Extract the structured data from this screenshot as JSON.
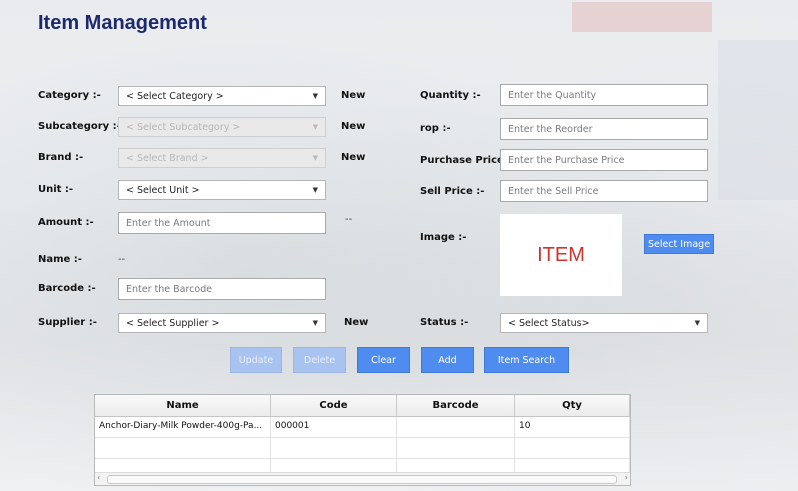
{
  "title": "Item Management",
  "labels": {
    "category": "Category :-",
    "subcategory": "Subcategory :-",
    "brand": "Brand :-",
    "unit": "Unit :-",
    "amount": "Amount :-",
    "name": "Name :-",
    "barcode": "Barcode :-",
    "supplier": "Supplier :-",
    "quantity": "Quantity :-",
    "rop": "rop :-",
    "purchase_price": "Purchase Price :-",
    "sell_price": "Sell Price :-",
    "image": "Image :-",
    "status": "Status :-"
  },
  "new_link": "New",
  "selects": {
    "category": "< Select Category >",
    "subcategory": "< Select Subcategory >",
    "brand": "< Select Brand >",
    "unit": "< Select Unit >",
    "supplier": "< Select Supplier >",
    "status": "< Select Status>"
  },
  "placeholders": {
    "amount": "Enter the Amount",
    "barcode": "Enter the Barcode",
    "quantity": "Enter the Quantity",
    "rop": "Enter the Reorder",
    "purchase_price": "Enter the Purchase Price",
    "sell_price": "Enter the Sell Price"
  },
  "name_value": "--",
  "amount_suffix": "--",
  "image_text": "ITEM",
  "buttons": {
    "select_image": "Select Image",
    "update": "Update",
    "delete": "Delete",
    "clear": "Clear",
    "add": "Add",
    "item_search": "Item Search"
  },
  "table": {
    "headers": [
      "Name",
      "Code",
      "Barcode",
      "Qty"
    ],
    "rows": [
      [
        "Anchor-Diary-Milk Powder-400g-Pa...",
        "000001",
        "",
        "10"
      ]
    ]
  },
  "colors": {
    "title": "#1c2a6b",
    "button": "#4f8cf0",
    "image_text": "#d2332d"
  },
  "icons": {
    "dropdown": "chevron-down-icon",
    "scroll_left": "arrow-left-icon",
    "scroll_right": "arrow-right-icon"
  }
}
